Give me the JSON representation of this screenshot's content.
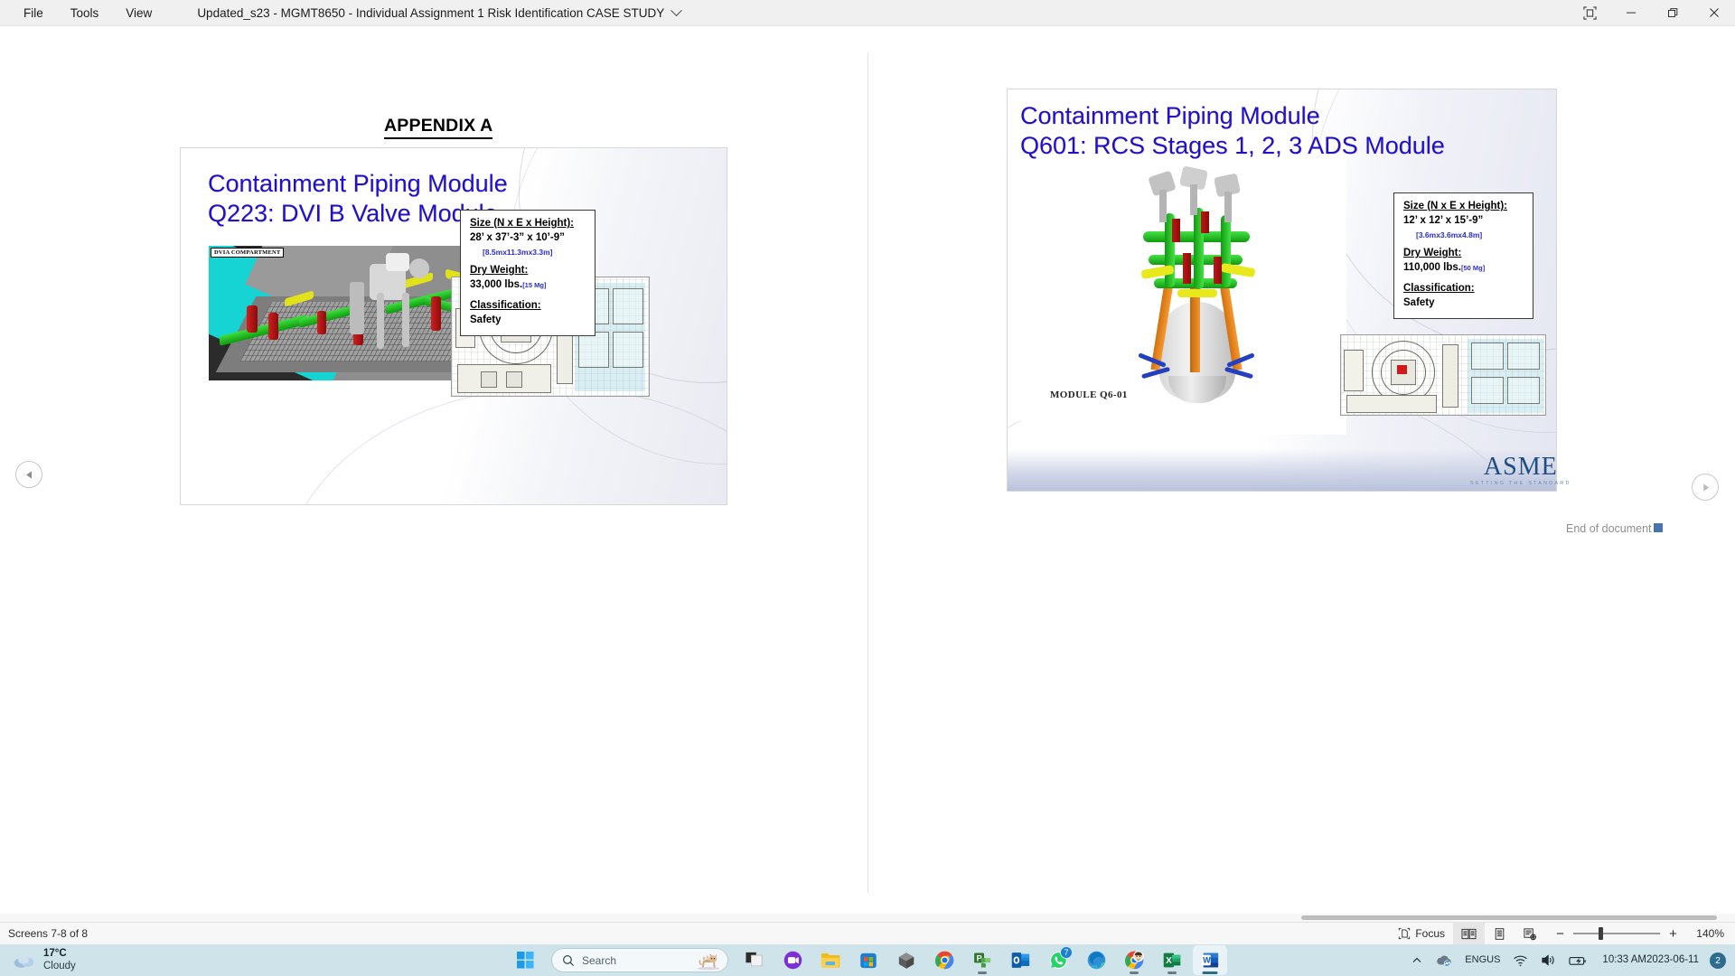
{
  "titlebar": {
    "menus": [
      "File",
      "Tools",
      "View"
    ],
    "doc_title": "Updated_s23 - MGMT8650 - Individual Assignment 1 Risk Identification CASE STUDY",
    "controls": [
      "immersive-reader",
      "minimize",
      "restore",
      "close"
    ]
  },
  "document": {
    "appendix_heading": "APPENDIX A ",
    "end_of_document": "End of document",
    "nav_prev": "◀",
    "nav_next": "▶",
    "slide1": {
      "title": "Containment Piping Module\nQ223: DVI B Valve Module",
      "render_label": "DVIA COMPARTMENT",
      "spec": {
        "size_header": "Size (N x E x Height):",
        "size_value": "28’ x 37’-3” x 10’-9”",
        "size_metric": "[8.5mx11.3mx3.3m]",
        "weight_header": "Dry Weight:",
        "weight_value": "33,000 lbs.",
        "weight_metric": "[15 Mg]",
        "class_header": "Classification:",
        "class_value": "Safety"
      }
    },
    "slide2": {
      "title": "Containment Piping Module\nQ601: RCS Stages 1, 2, 3 ADS Module",
      "module_label": "MODULE   Q6-01",
      "logo_text": "ASME",
      "logo_tagline": "SETTING THE STANDARD",
      "spec": {
        "size_header": "Size (N x E x Height):",
        "size_value": "12’ x 12’ x 15’-9”",
        "size_metric": "[3.6mx3.6mx4.8m]",
        "weight_header": "Dry Weight:",
        "weight_value": "110,000 lbs.",
        "weight_metric": "[50 Mg]",
        "class_header": "Classification:",
        "class_value": "Safety"
      }
    }
  },
  "statusbar": {
    "screens": "Screens 7-8 of 8",
    "focus": "Focus",
    "views": [
      "side-to-side-view",
      "vertical-view",
      "web-layout-view"
    ],
    "zoom_out": "−",
    "zoom_in": "+",
    "zoom_level": "140%"
  },
  "taskbar": {
    "weather_temp": "17°C",
    "weather_desc": "Cloudy",
    "search_placeholder": "Search",
    "icons": [
      "start-icon",
      "task-view-icon",
      "teams-icon",
      "file-explorer-icon",
      "store-icon",
      "blender-icon",
      "chrome-icon",
      "project-icon",
      "outlook-icon",
      "whatsapp-icon",
      "edge-icon",
      "chrome-profile-icon",
      "excel-icon",
      "word-icon"
    ],
    "whatsapp_badge": "7",
    "tray_show_hidden": "˄",
    "tray_onedrive": "onedrive-icon",
    "language": "ENG",
    "language_region": "US",
    "tray_wifi": "wifi-icon",
    "tray_volume": "volume-icon",
    "tray_battery": "battery-icon",
    "clock_time": "10:33 AM",
    "clock_date": "2023-06-11",
    "notification_count": "2"
  },
  "colors": {
    "title_blue": "#1a12cf",
    "metric_blue": "#2b2bd0",
    "accent": "#4874ab",
    "taskbar_bg": "#cfe3ea"
  }
}
